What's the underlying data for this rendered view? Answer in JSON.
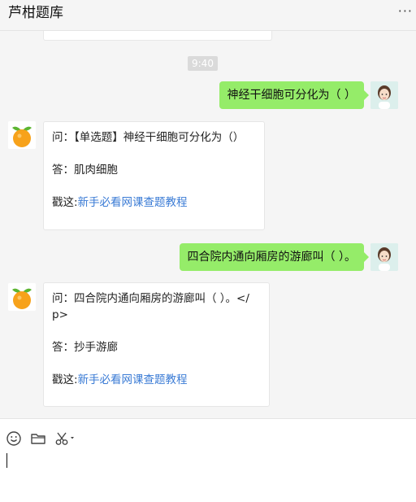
{
  "window": {
    "title": "芦柑题库"
  },
  "chat": {
    "timestamp": "9:40",
    "messages": [
      {
        "user_text": "神经干细胞可分化为（ ）",
        "question": "问：【单选题】神经干细胞可分化为（）",
        "answer": "答：肌肉细胞",
        "link_prefix": "戳这:",
        "link_text": "新手必看网课查题教程"
      },
      {
        "user_text": "四合院内通向厢房的游廊叫（ ）。",
        "question_line1": "问：四合院内通向厢房的游廊叫（ ）。</",
        "question_line2": "p>",
        "answer": "答：抄手游廊",
        "link_prefix": "戳这:",
        "link_text": "新手必看网课查题教程"
      }
    ]
  },
  "toolbar": {
    "icons": [
      "emoji-icon",
      "folder-icon",
      "scissors-icon"
    ]
  },
  "colors": {
    "user_bubble": "#95ec69",
    "link": "#3a7bd5",
    "background": "#f5f5f5"
  }
}
